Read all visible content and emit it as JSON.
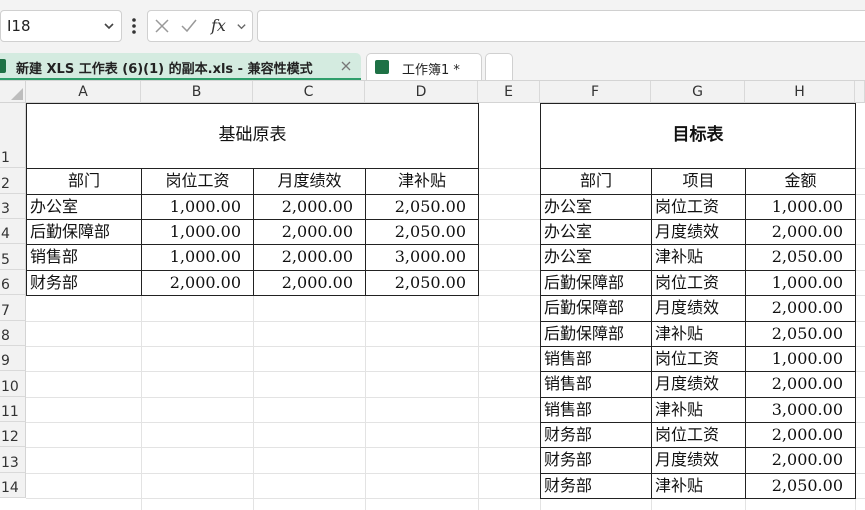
{
  "formula_bar": {
    "name_box": "I18",
    "formula": ""
  },
  "tabs": {
    "workbook": "新建 XLS 工作表 (6)(1) 的副本.xls  -  兼容性模式",
    "sheet": "工作簿1 *"
  },
  "columns": [
    "A",
    "B",
    "C",
    "D",
    "E",
    "F",
    "G",
    "H"
  ],
  "rows": [
    "1",
    "2",
    "3",
    "4",
    "5",
    "6",
    "7",
    "8",
    "9",
    "10",
    "11",
    "12",
    "13",
    "14"
  ],
  "source_table": {
    "title": "基础原表",
    "headers": [
      "部门",
      "岗位工资",
      "月度绩效",
      "津补贴"
    ],
    "rows": [
      [
        "办公室",
        "1,000.00",
        "2,000.00",
        "2,050.00"
      ],
      [
        "后勤保障部",
        "1,000.00",
        "2,000.00",
        "2,050.00"
      ],
      [
        "销售部",
        "1,000.00",
        "2,000.00",
        "3,000.00"
      ],
      [
        "财务部",
        "2,000.00",
        "2,000.00",
        "2,050.00"
      ]
    ]
  },
  "target_table": {
    "title": "目标表",
    "headers": [
      "部门",
      "项目",
      "金额"
    ],
    "rows": [
      [
        "办公室",
        "岗位工资",
        "1,000.00"
      ],
      [
        "办公室",
        "月度绩效",
        "2,000.00"
      ],
      [
        "办公室",
        "津补贴",
        "2,050.00"
      ],
      [
        "后勤保障部",
        "岗位工资",
        "1,000.00"
      ],
      [
        "后勤保障部",
        "月度绩效",
        "2,000.00"
      ],
      [
        "后勤保障部",
        "津补贴",
        "2,050.00"
      ],
      [
        "销售部",
        "岗位工资",
        "1,000.00"
      ],
      [
        "销售部",
        "月度绩效",
        "2,000.00"
      ],
      [
        "销售部",
        "津补贴",
        "3,000.00"
      ],
      [
        "财务部",
        "岗位工资",
        "2,000.00"
      ],
      [
        "财务部",
        "月度绩效",
        "2,000.00"
      ],
      [
        "财务部",
        "津补贴",
        "2,050.00"
      ]
    ]
  },
  "colors": {
    "active_tab": "#d4ebe0",
    "accent": "#2f9e6b",
    "excel_icon": "#1e7145"
  }
}
